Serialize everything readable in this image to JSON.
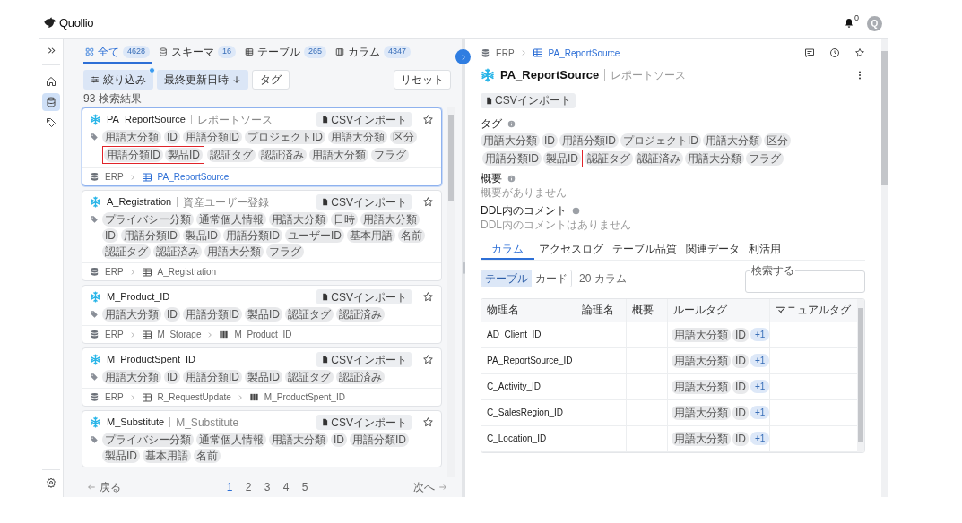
{
  "header": {
    "brand": "Quollio",
    "notification_count": "0",
    "avatar": "Q"
  },
  "rail": {
    "items": [
      {
        "kind": "home",
        "selected": false
      },
      {
        "kind": "database",
        "selected": true
      },
      {
        "kind": "tag",
        "selected": false
      }
    ]
  },
  "search": {
    "tabs": [
      {
        "kind": "all",
        "label": "全て",
        "count": "4628",
        "selected": true
      },
      {
        "kind": "schema",
        "label": "スキーマ",
        "count": "16",
        "selected": false
      },
      {
        "kind": "table",
        "label": "テーブル",
        "count": "265",
        "selected": false
      },
      {
        "kind": "column",
        "label": "カラム",
        "count": "4347",
        "selected": false
      }
    ],
    "filters": [
      {
        "kind": "filter",
        "label": "絞り込み",
        "active": true,
        "badge": true
      },
      {
        "kind": "sort",
        "label": "最終更新日時",
        "active": true,
        "badge": false
      },
      {
        "kind": "plain",
        "label": "タグ",
        "active": false,
        "badge": false
      }
    ],
    "reset": "リセット",
    "result_count": "93 検索結果",
    "results": [
      {
        "name": "PA_ReportSource",
        "logical_name": "レポートソース",
        "selected": true,
        "import": "CSVインポート",
        "tags": [
          {
            "kind": "tag",
            "label": "用語大分類"
          },
          {
            "kind": "tag",
            "label": "ID"
          },
          {
            "kind": "tag",
            "label": "用語分類ID"
          },
          {
            "kind": "tag",
            "label": "プロジェクトID"
          },
          {
            "kind": "tag",
            "label": "用語大分類"
          },
          {
            "kind": "tag",
            "label": "区分"
          },
          {
            "kind": "highlight",
            "tags": [
              {
                "label": "用語分類ID"
              },
              {
                "label": "製品ID"
              }
            ]
          },
          {
            "kind": "tag",
            "label": "認証タグ"
          },
          {
            "kind": "tag",
            "label": "認証済み"
          },
          {
            "kind": "tag",
            "label": "用語大分類"
          },
          {
            "kind": "tag",
            "label": "フラグ"
          }
        ],
        "path": [
          {
            "kind": "schema",
            "label": "ERP"
          },
          {
            "kind": "table",
            "label": "PA_ReportSource"
          }
        ]
      },
      {
        "name": "A_Registration",
        "logical_name": "資産ユーザー登録",
        "selected": false,
        "import": "CSVインポート",
        "tags": [
          {
            "kind": "tag",
            "label": "プライバシー分類"
          },
          {
            "kind": "tag",
            "label": "通常個人情報"
          },
          {
            "kind": "tag",
            "label": "用語大分類"
          },
          {
            "kind": "tag",
            "label": "日時"
          },
          {
            "kind": "tag",
            "label": "用語大分類"
          },
          {
            "kind": "tag",
            "label": "ID"
          },
          {
            "kind": "tag",
            "label": "用語分類ID"
          },
          {
            "kind": "tag",
            "label": "製品ID"
          },
          {
            "kind": "tag",
            "label": "用語分類ID"
          },
          {
            "kind": "tag",
            "label": "ユーザーID"
          },
          {
            "kind": "tag",
            "label": "基本用語"
          },
          {
            "kind": "tag",
            "label": "名前"
          },
          {
            "kind": "tag",
            "label": "認証タグ"
          },
          {
            "kind": "tag",
            "label": "認証済み"
          },
          {
            "kind": "tag",
            "label": "用語大分類"
          },
          {
            "kind": "tag",
            "label": "フラグ"
          }
        ],
        "path": [
          {
            "kind": "schema",
            "label": "ERP"
          },
          {
            "kind": "table",
            "label": "A_Registration"
          }
        ]
      },
      {
        "name": "M_Product_ID",
        "selected": false,
        "import": "CSVインポート",
        "tags": [
          {
            "kind": "tag",
            "label": "用語大分類"
          },
          {
            "kind": "tag",
            "label": "ID"
          },
          {
            "kind": "tag",
            "label": "用語分類ID"
          },
          {
            "kind": "tag",
            "label": "製品ID"
          },
          {
            "kind": "tag",
            "label": "認証タグ"
          },
          {
            "kind": "tag",
            "label": "認証済み"
          }
        ],
        "path": [
          {
            "kind": "schema",
            "label": "ERP"
          },
          {
            "kind": "table",
            "label": "M_Storage"
          },
          {
            "kind": "column",
            "label": "M_Product_ID"
          }
        ]
      },
      {
        "name": "M_ProductSpent_ID",
        "selected": false,
        "import": "CSVインポート",
        "tags": [
          {
            "kind": "tag",
            "label": "用語大分類"
          },
          {
            "kind": "tag",
            "label": "ID"
          },
          {
            "kind": "tag",
            "label": "用語分類ID"
          },
          {
            "kind": "tag",
            "label": "製品ID"
          },
          {
            "kind": "tag",
            "label": "認証タグ"
          },
          {
            "kind": "tag",
            "label": "認証済み"
          }
        ],
        "path": [
          {
            "kind": "schema",
            "label": "ERP"
          },
          {
            "kind": "table",
            "label": "R_RequestUpdate"
          },
          {
            "kind": "column",
            "label": "M_ProductSpent_ID"
          }
        ]
      },
      {
        "name": "M_Substitute",
        "logical_name": "M_Substitute",
        "selected": false,
        "import": "CSVインポート",
        "tags": [
          {
            "kind": "tag",
            "label": "プライバシー分類"
          },
          {
            "kind": "tag",
            "label": "通常個人情報"
          },
          {
            "kind": "tag",
            "label": "用語大分類"
          },
          {
            "kind": "tag",
            "label": "ID"
          },
          {
            "kind": "tag",
            "label": "用語分類ID"
          },
          {
            "kind": "tag",
            "label": "製品ID"
          },
          {
            "kind": "tag",
            "label": "基本用語"
          },
          {
            "kind": "tag",
            "label": "名前"
          }
        ]
      }
    ],
    "pagination": {
      "prev": "戻る",
      "pages": [
        {
          "label": "1",
          "selected": true
        },
        {
          "label": "2",
          "selected": false
        },
        {
          "label": "3",
          "selected": false
        },
        {
          "label": "4",
          "selected": false
        },
        {
          "label": "5",
          "selected": false
        }
      ],
      "next": "次へ"
    }
  },
  "detail": {
    "breadcrumb": [
      {
        "kind": "schema",
        "label": "ERP"
      },
      {
        "kind": "table",
        "label": "PA_ReportSource"
      }
    ],
    "name": "PA_ReportSource",
    "logical_name": "レポートソース",
    "import": "CSVインポート",
    "tags_label": "タグ",
    "tags": [
      {
        "kind": "tag",
        "label": "用語大分類"
      },
      {
        "kind": "tag",
        "label": "ID"
      },
      {
        "kind": "tag",
        "label": "用語分類ID"
      },
      {
        "kind": "tag",
        "label": "プロジェクトID"
      },
      {
        "kind": "tag",
        "label": "用語大分類"
      },
      {
        "kind": "tag",
        "label": "区分"
      },
      {
        "kind": "highlight",
        "tags": [
          {
            "label": "用語分類ID"
          },
          {
            "label": "製品ID"
          }
        ]
      },
      {
        "kind": "tag",
        "label": "認証タグ"
      },
      {
        "kind": "tag",
        "label": "認証済み"
      },
      {
        "kind": "tag",
        "label": "用語大分類"
      },
      {
        "kind": "tag",
        "label": "フラグ"
      }
    ],
    "summary_label": "概要",
    "summary": "概要がありません",
    "ddl_label": "DDL内のコメント",
    "ddl": "DDL内のコメントはありません",
    "tabs": [
      {
        "label": "カラム",
        "selected": true
      },
      {
        "label": "アクセスログ",
        "selected": false
      },
      {
        "label": "テーブル品質",
        "selected": false
      },
      {
        "label": "関連データ",
        "selected": false
      },
      {
        "label": "利活用",
        "selected": false
      }
    ],
    "view_toggle": [
      {
        "label": "テーブル",
        "selected": true
      },
      {
        "label": "カード",
        "selected": false
      }
    ],
    "column_count": "20 カラム",
    "search": {
      "label": "検索する"
    },
    "table": {
      "columns": [
        "物理名",
        "論理名",
        "概要",
        "ルールタグ",
        "マニュアルタグ"
      ],
      "rows": [
        {
          "physical_name": "AD_Client_ID",
          "rule_tags": [
            {
              "kind": "tag",
              "label": "用語大分類"
            },
            {
              "kind": "tag",
              "label": "ID"
            },
            {
              "kind": "more",
              "label": "+1"
            }
          ]
        },
        {
          "physical_name": "PA_ReportSource_ID",
          "rule_tags": [
            {
              "kind": "tag",
              "label": "用語大分類"
            },
            {
              "kind": "tag",
              "label": "ID"
            },
            {
              "kind": "more",
              "label": "+1"
            }
          ]
        },
        {
          "physical_name": "C_Activity_ID",
          "rule_tags": [
            {
              "kind": "tag",
              "label": "用語大分類"
            },
            {
              "kind": "tag",
              "label": "ID"
            },
            {
              "kind": "more",
              "label": "+1"
            }
          ]
        },
        {
          "physical_name": "C_SalesRegion_ID",
          "rule_tags": [
            {
              "kind": "tag",
              "label": "用語大分類"
            },
            {
              "kind": "tag",
              "label": "ID"
            },
            {
              "kind": "more",
              "label": "+1"
            }
          ]
        },
        {
          "physical_name": "C_Location_ID",
          "rule_tags": [
            {
              "kind": "tag",
              "label": "用語大分類"
            },
            {
              "kind": "tag",
              "label": "ID"
            },
            {
              "kind": "more",
              "label": "+1"
            }
          ]
        }
      ]
    }
  }
}
